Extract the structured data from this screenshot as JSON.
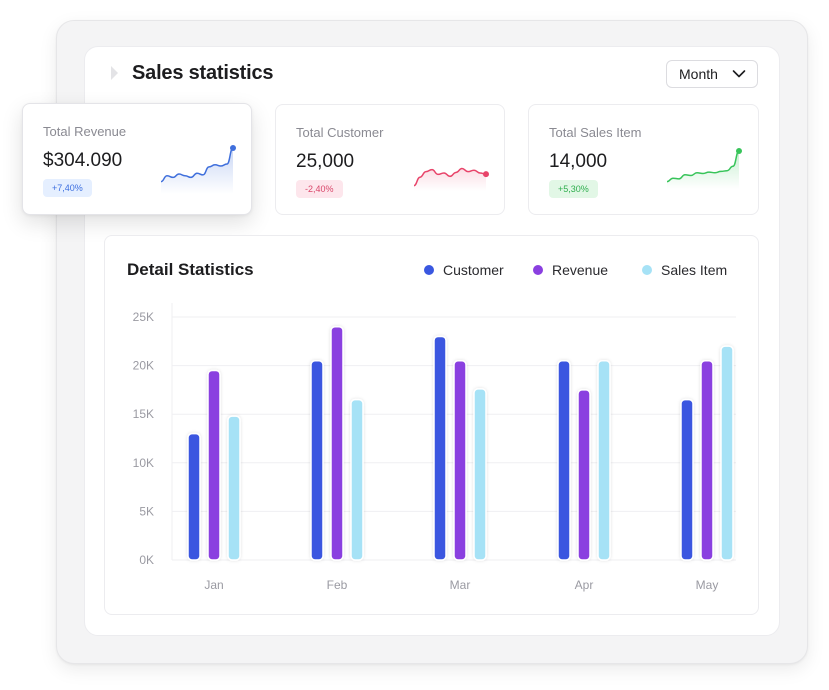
{
  "header": {
    "title": "Sales statistics"
  },
  "period_select": {
    "value": "Month"
  },
  "cards": [
    {
      "label": "Total Revenue",
      "value": "$304.090",
      "change": "+7,40%",
      "badge_bg": "#e5efff",
      "badge_fg": "#3d6fe0",
      "line_color": "#3f6fdc",
      "fill_color": "#3f6fdc",
      "trend": [
        0.2,
        0.34,
        0.3,
        0.38,
        0.34,
        0.3,
        0.4,
        0.36,
        0.55,
        0.6,
        0.57,
        0.62,
        1.0
      ]
    },
    {
      "label": "Total Customer",
      "value": "25,000",
      "change": "-2,40%",
      "badge_bg": "#fde6ec",
      "badge_fg": "#d9476a",
      "line_color": "#e8446a",
      "fill_color": "#f08aa2",
      "trend": [
        0.05,
        0.35,
        0.55,
        0.62,
        0.45,
        0.5,
        0.38,
        0.52,
        0.66,
        0.55,
        0.6,
        0.5,
        0.46
      ]
    },
    {
      "label": "Total Sales Item",
      "value": "14,000",
      "change": "+5,30%",
      "badge_bg": "#e2f7e6",
      "badge_fg": "#2fae4e",
      "line_color": "#38c45a",
      "fill_color": "#38c45a",
      "trend": [
        0.1,
        0.2,
        0.18,
        0.3,
        0.28,
        0.36,
        0.34,
        0.38,
        0.36,
        0.4,
        0.42,
        0.55,
        1.0
      ]
    }
  ],
  "detail": {
    "title": "Detail Statistics",
    "legend": [
      {
        "name": "Customer",
        "color": "#3a57e0"
      },
      {
        "name": "Revenue",
        "color": "#8a3fe0"
      },
      {
        "name": "Sales Item",
        "color": "#a6e2f6"
      }
    ]
  },
  "chart_data": {
    "type": "bar",
    "categories": [
      "Jan",
      "Feb",
      "Mar",
      "Apr",
      "May"
    ],
    "y_ticks": [
      "0K",
      "5K",
      "10K",
      "15K",
      "20K",
      "25K"
    ],
    "ylim": [
      0,
      25000
    ],
    "grid": true,
    "legend_position": "top-right",
    "series": [
      {
        "name": "Customer",
        "color": "#3a57e0",
        "values": [
          13000,
          20500,
          23000,
          20500,
          16500
        ]
      },
      {
        "name": "Revenue",
        "color": "#8a3fe0",
        "values": [
          19500,
          24000,
          20500,
          17500,
          20500
        ]
      },
      {
        "name": "Sales Item",
        "color": "#a6e2f6",
        "values": [
          14800,
          16500,
          17600,
          20500,
          22000
        ]
      }
    ]
  }
}
